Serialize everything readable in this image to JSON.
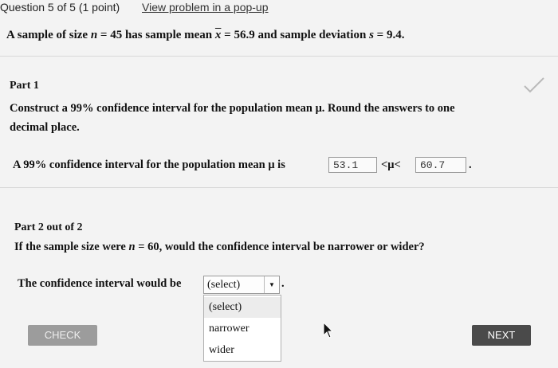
{
  "header": {
    "question_status": "Question 5 of 5 (1 point)",
    "popup_link": "View problem in a pop-up"
  },
  "problem": {
    "p1": "A sample of size ",
    "n_symbol": "n",
    "p2": " = 45 has sample mean ",
    "xbar_symbol": "x",
    "p3": " = 56.9 and sample deviation ",
    "s_symbol": "s",
    "p4": " = 9.4."
  },
  "part1": {
    "title": "Part 1",
    "instruction_line1": "Construct a 99% confidence interval for the population mean μ. Round the answers to one",
    "instruction_line2": "decimal place.",
    "sentence_prefix": "A 99% confidence interval for the population mean μ is",
    "lower_value": "53.1",
    "middle": "<μ<",
    "upper_value": "60.7",
    "end": "."
  },
  "part2": {
    "title": "Part 2 out of 2",
    "question_p1": "If the sample size were ",
    "n_symbol": "n",
    "question_p2": " = 60, would the confidence interval be narrower or wider?",
    "sentence_prefix": "The confidence interval would be",
    "select_value": "(select)",
    "select_arrow": "▼",
    "end": ".",
    "options": [
      "(select)",
      "narrower",
      "wider"
    ]
  },
  "buttons": {
    "check": "CHECK",
    "next": "NEXT"
  }
}
